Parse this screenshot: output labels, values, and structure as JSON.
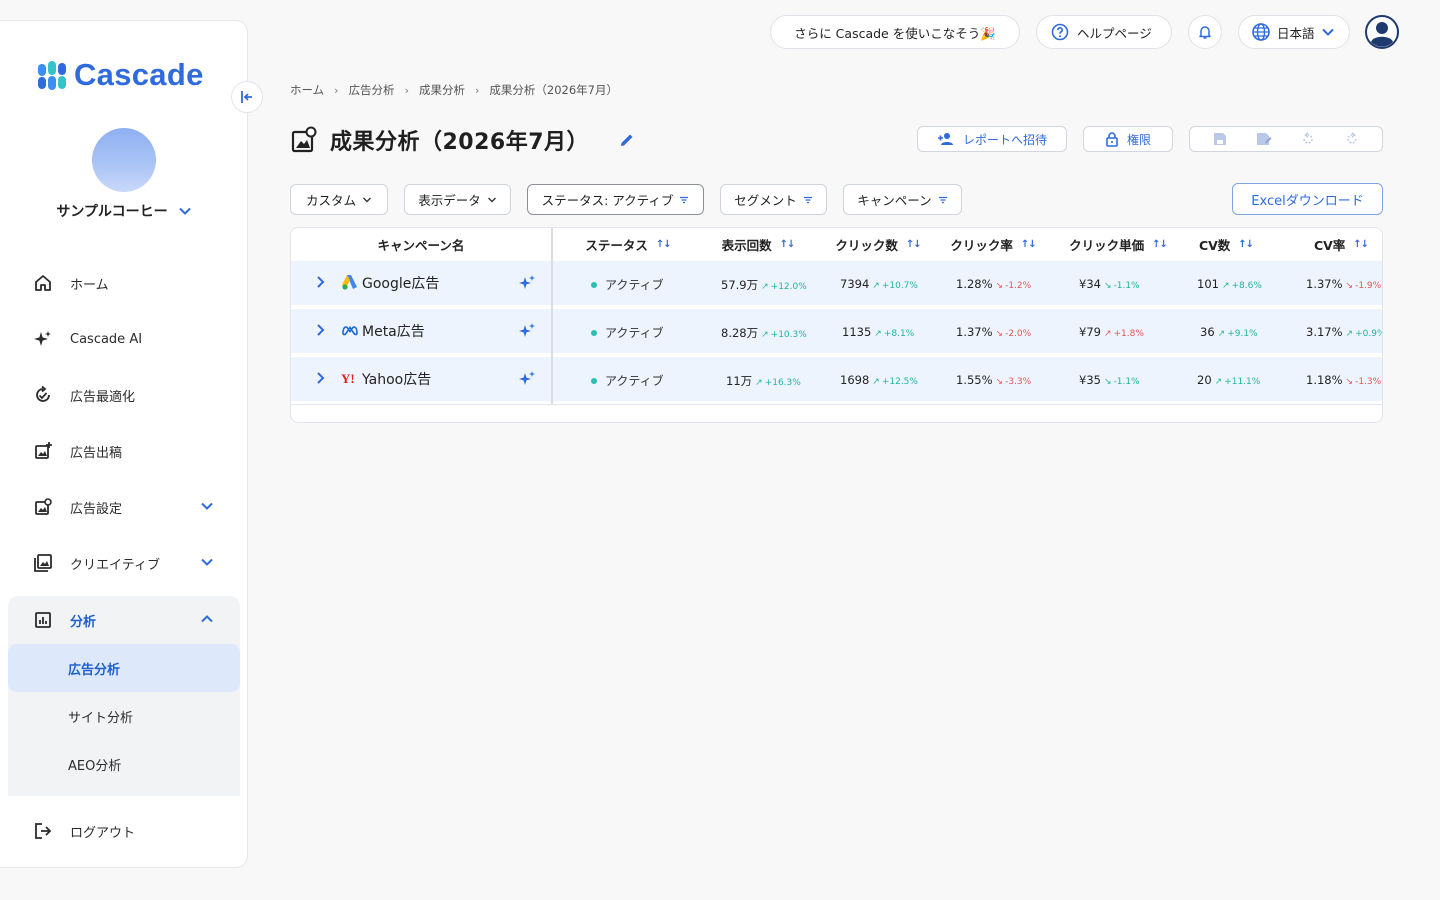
{
  "brand": {
    "name": "Cascade"
  },
  "account": {
    "name": "サンプルコーヒー"
  },
  "nav": {
    "home": "ホーム",
    "ai": "Cascade AI",
    "optimize": "広告最適化",
    "post": "広告出稿",
    "settings": "広告設定",
    "creative": "クリエイティブ",
    "analysis": "分析",
    "sub": {
      "ad_analysis": "広告分析",
      "site_analysis": "サイト分析",
      "aeo_analysis": "AEO分析"
    },
    "logout": "ログアウト"
  },
  "topbar": {
    "promo": "さらに Cascade を使いこなそう🎉",
    "help": "ヘルプページ",
    "language": "日本語"
  },
  "breadcrumb": [
    "ホーム",
    "広告分析",
    "成果分析",
    "成果分析（2026年7月）"
  ],
  "page": {
    "title": "成果分析（2026年7月）",
    "invite": "レポートへ招待",
    "permission": "権限"
  },
  "filters": {
    "custom": "カスタム",
    "display_data": "表示データ",
    "status": "ステータス: アクティブ",
    "segment": "セグメント",
    "campaign": "キャンペーン",
    "excel": "Excelダウンロード"
  },
  "table": {
    "headers": {
      "campaign": "キャンペーン名",
      "status": "ステータス",
      "impressions": "表示回数",
      "clicks": "クリック数",
      "ctr": "クリック率",
      "cpc": "クリック単価",
      "cv": "CV数",
      "cvr": "CV率"
    },
    "rows": [
      {
        "name": "Google広告",
        "status": "アクティブ",
        "impressions": "57.9万",
        "impressions_d": "+12.0%",
        "clicks": "7394",
        "clicks_d": "+10.7%",
        "ctr": "1.28%",
        "ctr_d": "-1.2%",
        "cpc": "¥34",
        "cpc_d": "-1.1%",
        "cv": "101",
        "cv_d": "+8.6%",
        "cvr": "1.37%",
        "cvr_d": "-1.9%"
      },
      {
        "name": "Meta広告",
        "status": "アクティブ",
        "impressions": "8.28万",
        "impressions_d": "+10.3%",
        "clicks": "1135",
        "clicks_d": "+8.1%",
        "ctr": "1.37%",
        "ctr_d": "-2.0%",
        "cpc": "¥79",
        "cpc_d": "+1.8%",
        "cv": "36",
        "cv_d": "+9.1%",
        "cvr": "3.17%",
        "cvr_d": "+0.9%"
      },
      {
        "name": "Yahoo広告",
        "status": "アクティブ",
        "impressions": "11万",
        "impressions_d": "+16.3%",
        "clicks": "1698",
        "clicks_d": "+12.5%",
        "ctr": "1.55%",
        "ctr_d": "-3.3%",
        "cpc": "¥35",
        "cpc_d": "-1.1%",
        "cv": "20",
        "cv_d": "+11.1%",
        "cvr": "1.18%",
        "cvr_d": "-1.3%"
      }
    ]
  },
  "colors": {
    "accent": "#2f6bdc",
    "up": "#1eb5a2",
    "down": "#e05757",
    "row_bg": "#eef4fd",
    "active_nav": "#dde9fb"
  },
  "icons": {
    "nav": [
      "home-icon",
      "sparkle-icon",
      "optimize-icon",
      "post-icon",
      "settings-icon",
      "image-icon",
      "chart-icon",
      "logout-icon"
    ],
    "topbar": [
      "help-icon",
      "bell-icon",
      "globe-icon",
      "user-avatar-icon"
    ]
  }
}
